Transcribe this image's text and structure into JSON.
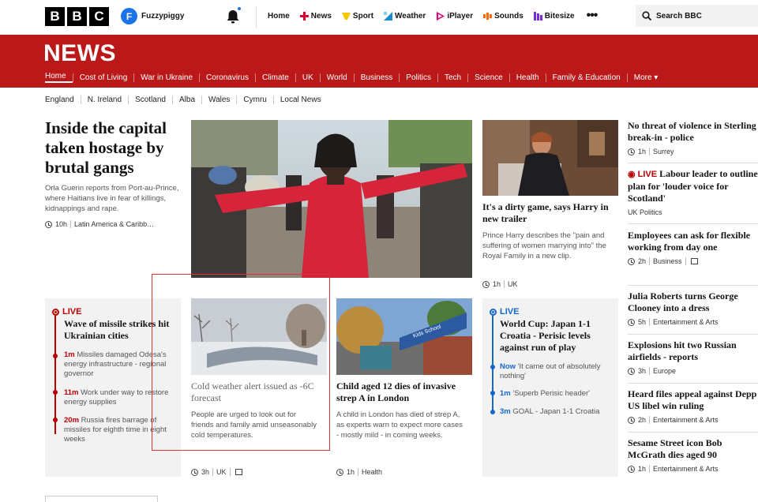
{
  "logo": {
    "letters": [
      "B",
      "B",
      "C"
    ]
  },
  "user": {
    "initial": "F",
    "name": "Fuzzypiggy"
  },
  "topnav": [
    {
      "label": "Home",
      "color": "#141414",
      "icon": ""
    },
    {
      "label": "News",
      "color": "#e0002e",
      "icon": "news-icon"
    },
    {
      "label": "Sport",
      "color": "#f7c600",
      "icon": "sport-icon"
    },
    {
      "label": "Weather",
      "color": "#1a8ccf",
      "icon": "weather-icon"
    },
    {
      "label": "iPlayer",
      "color": "#e0007a",
      "icon": "iplayer-icon"
    },
    {
      "label": "Sounds",
      "color": "#ff6600",
      "icon": "sounds-icon"
    },
    {
      "label": "Bitesize",
      "color": "#7a2bd9",
      "icon": "bitesize-icon"
    }
  ],
  "search": {
    "label": "Search BBC"
  },
  "banner": {
    "title": "NEWS",
    "color": "#bb1919"
  },
  "sections": [
    "Home",
    "Cost of Living",
    "War in Ukraine",
    "Coronavirus",
    "Climate",
    "UK",
    "World",
    "Business",
    "Politics",
    "Tech",
    "Science",
    "Health",
    "Family & Education",
    "More ▾"
  ],
  "subnav": [
    "England",
    "N. Ireland",
    "Scotland",
    "Alba",
    "Wales",
    "Cymru",
    "Local News"
  ],
  "lead": {
    "title": "Inside the capital taken hostage by brutal gangs",
    "summary": "Orla Guerin reports from Port-au-Prince, where Haitians live in fear of killings, kidnappings and rape.",
    "time": "10h",
    "tag": "Latin America & Caribb…"
  },
  "harry": {
    "title": "It's a dirty game, says Harry in new trailer",
    "summary": "Prince Harry describes the \"pain and suffering of women marrying into\" the Royal Family in a new clip.",
    "time": "1h",
    "tag": "UK"
  },
  "ukraine_live": {
    "live": "LIVE",
    "title": "Wave of missile strikes hit Ukrainian cities",
    "items": [
      {
        "time": "1m",
        "text": "Missiles damaged Odesa's energy infrastructure - regional governor"
      },
      {
        "time": "11m",
        "text": "Work under way to restore energy supplies"
      },
      {
        "time": "20m",
        "text": "Russia fires barrage of missiles for eighth time in eight weeks"
      }
    ]
  },
  "cold": {
    "title": "Cold weather alert issued as -6C forecast",
    "summary": "People are urged to look out for friends and family amid unseasonably cold temperatures.",
    "time": "3h",
    "tag": "UK"
  },
  "strep": {
    "title": "Child aged 12 dies of invasive strep A in London",
    "summary": "A child in London has died of strep A, as experts warn to expect more cases - mostly mild - in coming weeks.",
    "time": "1h",
    "tag": "Health",
    "school_sign": "Kids School"
  },
  "worldcup_live": {
    "live": "LIVE",
    "title": "World Cup: Japan 1-1 Croatia - Perisic levels against run of play",
    "items": [
      {
        "time": "Now",
        "text": "'It came out of absolutely nothing'"
      },
      {
        "time": "1m",
        "text": "'Superb Perisic header'"
      },
      {
        "time": "3m",
        "text": "GOAL - Japan 1-1 Croatia"
      }
    ]
  },
  "right": [
    {
      "title": "No threat of violence in Sterling break-in - police",
      "time": "1h",
      "tag": "Surrey"
    },
    {
      "live": "LIVE",
      "title": "Labour leader to outline plan for 'louder voice for Scotland'",
      "tag": "UK Politics"
    },
    {
      "title": "Employees can ask for flexible working from day one",
      "time": "2h",
      "tag": "Business"
    },
    {
      "title": "Julia Roberts turns George Clooney into a dress",
      "time": "5h",
      "tag": "Entertainment & Arts"
    },
    {
      "title": "Explosions hit two Russian airfields - reports",
      "time": "3h",
      "tag": "Europe"
    },
    {
      "title": "Heard files appeal against Depp US libel win ruling",
      "time": "2h",
      "tag": "Entertainment & Arts"
    },
    {
      "title": "Sesame Street icon Bob McGrath dies aged 90",
      "time": "1h",
      "tag": "Entertainment & Arts"
    }
  ]
}
